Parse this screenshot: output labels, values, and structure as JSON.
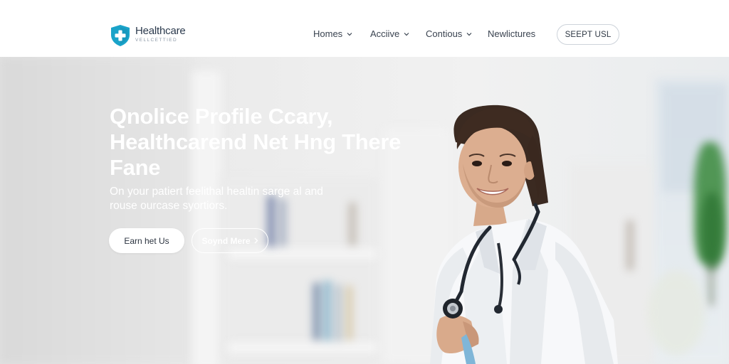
{
  "brand": {
    "name": "Healthcare",
    "tagline": "VELLCETTIED"
  },
  "nav": {
    "items": [
      {
        "label": "Homes",
        "has_dropdown": true
      },
      {
        "label": "Acciive",
        "has_dropdown": true
      },
      {
        "label": "Contious",
        "has_dropdown": true
      },
      {
        "label": "Newlictures",
        "has_dropdown": false
      }
    ],
    "cta_label": "SEEPT USL"
  },
  "hero": {
    "title": "Qnolice Profile Ccary, Healthcarend Net Hng There Fane",
    "subtitle": "On your patiert feelithal healtin sarge al and rouse ourcase syortiors.",
    "primary_button": "Earn het Us",
    "secondary_button": "Soynd Mere"
  },
  "colors": {
    "brand_accent": "#1aa3c9",
    "header_bg": "#ffffff",
    "hero_text": "#ffffff"
  },
  "icons": [
    "shield-cross-icon",
    "chevron-down-icon",
    "chevron-right-icon"
  ]
}
